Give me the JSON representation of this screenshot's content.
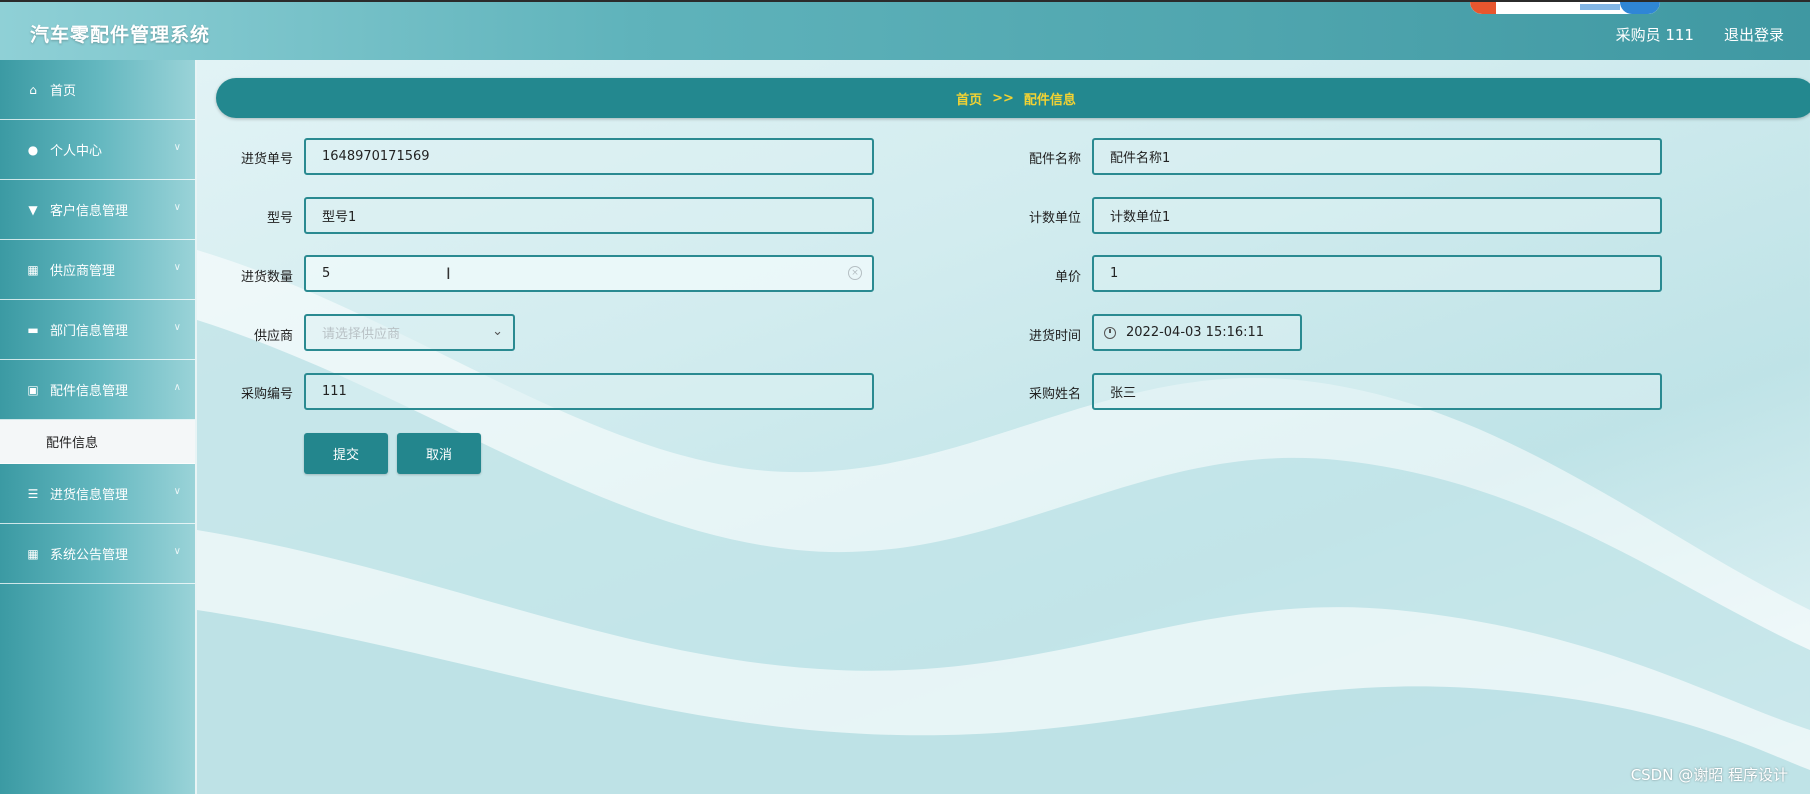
{
  "header": {
    "app_title": "汽车零配件管理系统",
    "user_label": "采购员 111",
    "logout_label": "退出登录"
  },
  "sidebar": {
    "items": [
      {
        "label": "首页",
        "icon": "home-icon"
      },
      {
        "label": "个人中心",
        "icon": "user-icon"
      },
      {
        "label": "客户信息管理",
        "icon": "customer-icon"
      },
      {
        "label": "供应商管理",
        "icon": "grid-icon"
      },
      {
        "label": "部门信息管理",
        "icon": "department-icon"
      },
      {
        "label": "配件信息管理",
        "icon": "chart-icon"
      },
      {
        "label": "进货信息管理",
        "icon": "sliders-icon"
      },
      {
        "label": "系统公告管理",
        "icon": "grid-icon"
      }
    ],
    "subitem": "配件信息"
  },
  "breadcrumb": {
    "home": "首页",
    "separator": ">>",
    "current": "配件信息"
  },
  "form": {
    "purchase_no": {
      "label": "进货单号",
      "value": "1648970171569"
    },
    "part_name": {
      "label": "配件名称",
      "value": "配件名称1"
    },
    "model": {
      "label": "型号",
      "value": "型号1"
    },
    "unit": {
      "label": "计数单位",
      "value": "计数单位1"
    },
    "quantity": {
      "label": "进货数量",
      "value": "5"
    },
    "price": {
      "label": "单价",
      "value": "1"
    },
    "supplier": {
      "label": "供应商",
      "placeholder": "请选择供应商"
    },
    "purchase_time": {
      "label": "进货时间",
      "value": "2022-04-03 15:16:11"
    },
    "buyer_id": {
      "label": "采购编号",
      "value": "111"
    },
    "buyer_name": {
      "label": "采购姓名",
      "value": "张三"
    }
  },
  "buttons": {
    "submit": "提交",
    "cancel": "取消"
  },
  "watermark": "CSDN @谢昭  程序设计",
  "colors": {
    "accent": "#23888f",
    "breadcrumb_text": "#f2d233"
  }
}
